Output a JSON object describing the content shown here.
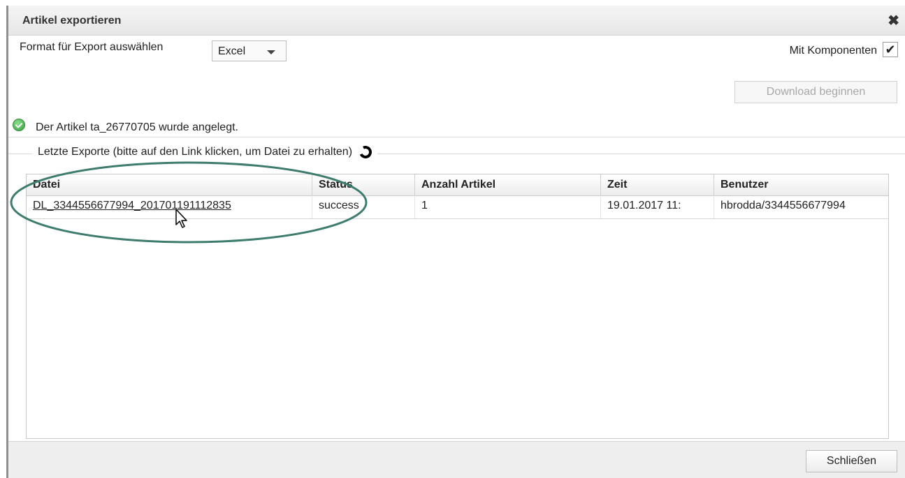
{
  "dialog": {
    "title": "Artikel exportieren",
    "close_glyph": "✖"
  },
  "format": {
    "label": "Format für Export auswählen",
    "selected": "Excel"
  },
  "components": {
    "label": "Mit Komponenten",
    "checked": true,
    "check_glyph": "✔"
  },
  "download_button": "Download beginnen",
  "status_message": "Der Artikel ta_26770705 wurde angelegt.",
  "exports": {
    "legend": "Letzte Exporte (bitte auf den Link klicken, um Datei zu erhalten)",
    "columns": [
      "Datei",
      "Status",
      "Anzahl Artikel",
      "Zeit",
      "Benutzer"
    ],
    "rows": [
      {
        "datei": "DL_3344556677994_201701191112835",
        "status": "success",
        "anzahl": "1",
        "zeit": "19.01.2017 11:",
        "benutzer": "hbrodda/3344556677994"
      }
    ]
  },
  "close_button": "Schließen",
  "icons": {
    "success": "check-circle-icon",
    "spinner": "loading-spinner-icon",
    "cursor": "mouse-pointer-icon"
  },
  "colors": {
    "annotation": "#3e7c6e",
    "success": "#2e9e3a"
  }
}
